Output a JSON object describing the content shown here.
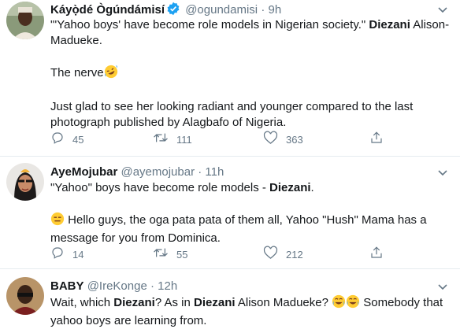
{
  "tweets": [
    {
      "name": "Káyọ̀dé Ògúndámisí",
      "handle": "@ogundamisi",
      "dot": "·",
      "time": "9h",
      "text_pre": "\"'Yahoo boys' have become role models in Nigerian society.\" ",
      "text_bold": "Diezani",
      "text_post": " Alison-Madueke.",
      "line2": "The nerve",
      "line3": "Just glad to see her looking radiant and younger compared to the last photograph published by Alagbafo of Nigeria.",
      "replies": "45",
      "retweets": "111",
      "likes": "363"
    },
    {
      "name": "AyeMojubar",
      "handle": "@ayemojubar",
      "dot": "·",
      "time": "11h",
      "text_pre": "\"Yahoo\" boys have become role models - ",
      "text_bold": "Diezani",
      "text_post": ".",
      "line2": "Hello guys, the oga pata pata of them all, Yahoo \"Hush\" Mama has a message for you from Dominica.",
      "replies": "14",
      "retweets": "55",
      "likes": "212"
    },
    {
      "name": "BABY",
      "handle": "@IreKonge",
      "dot": "·",
      "time": "12h",
      "t_a": "Wait, which ",
      "t_b1": "Diezani",
      "t_c": "? As in ",
      "t_b2": "Diezani",
      "t_d": " Alison Madueke? ",
      "t_e": " Somebody that yahoo boys are learning from."
    }
  ],
  "colors": {
    "text": "#14171a",
    "secondary": "#657786",
    "verified": "#1da1f2",
    "divider": "#e6ecf0"
  },
  "icons": [
    "verified-badge-icon",
    "chevron-down-icon",
    "reply-icon",
    "retweet-icon",
    "like-icon",
    "share-icon",
    "rofl-emoji",
    "expressionless-emoji",
    "tears-of-joy-emoji"
  ]
}
